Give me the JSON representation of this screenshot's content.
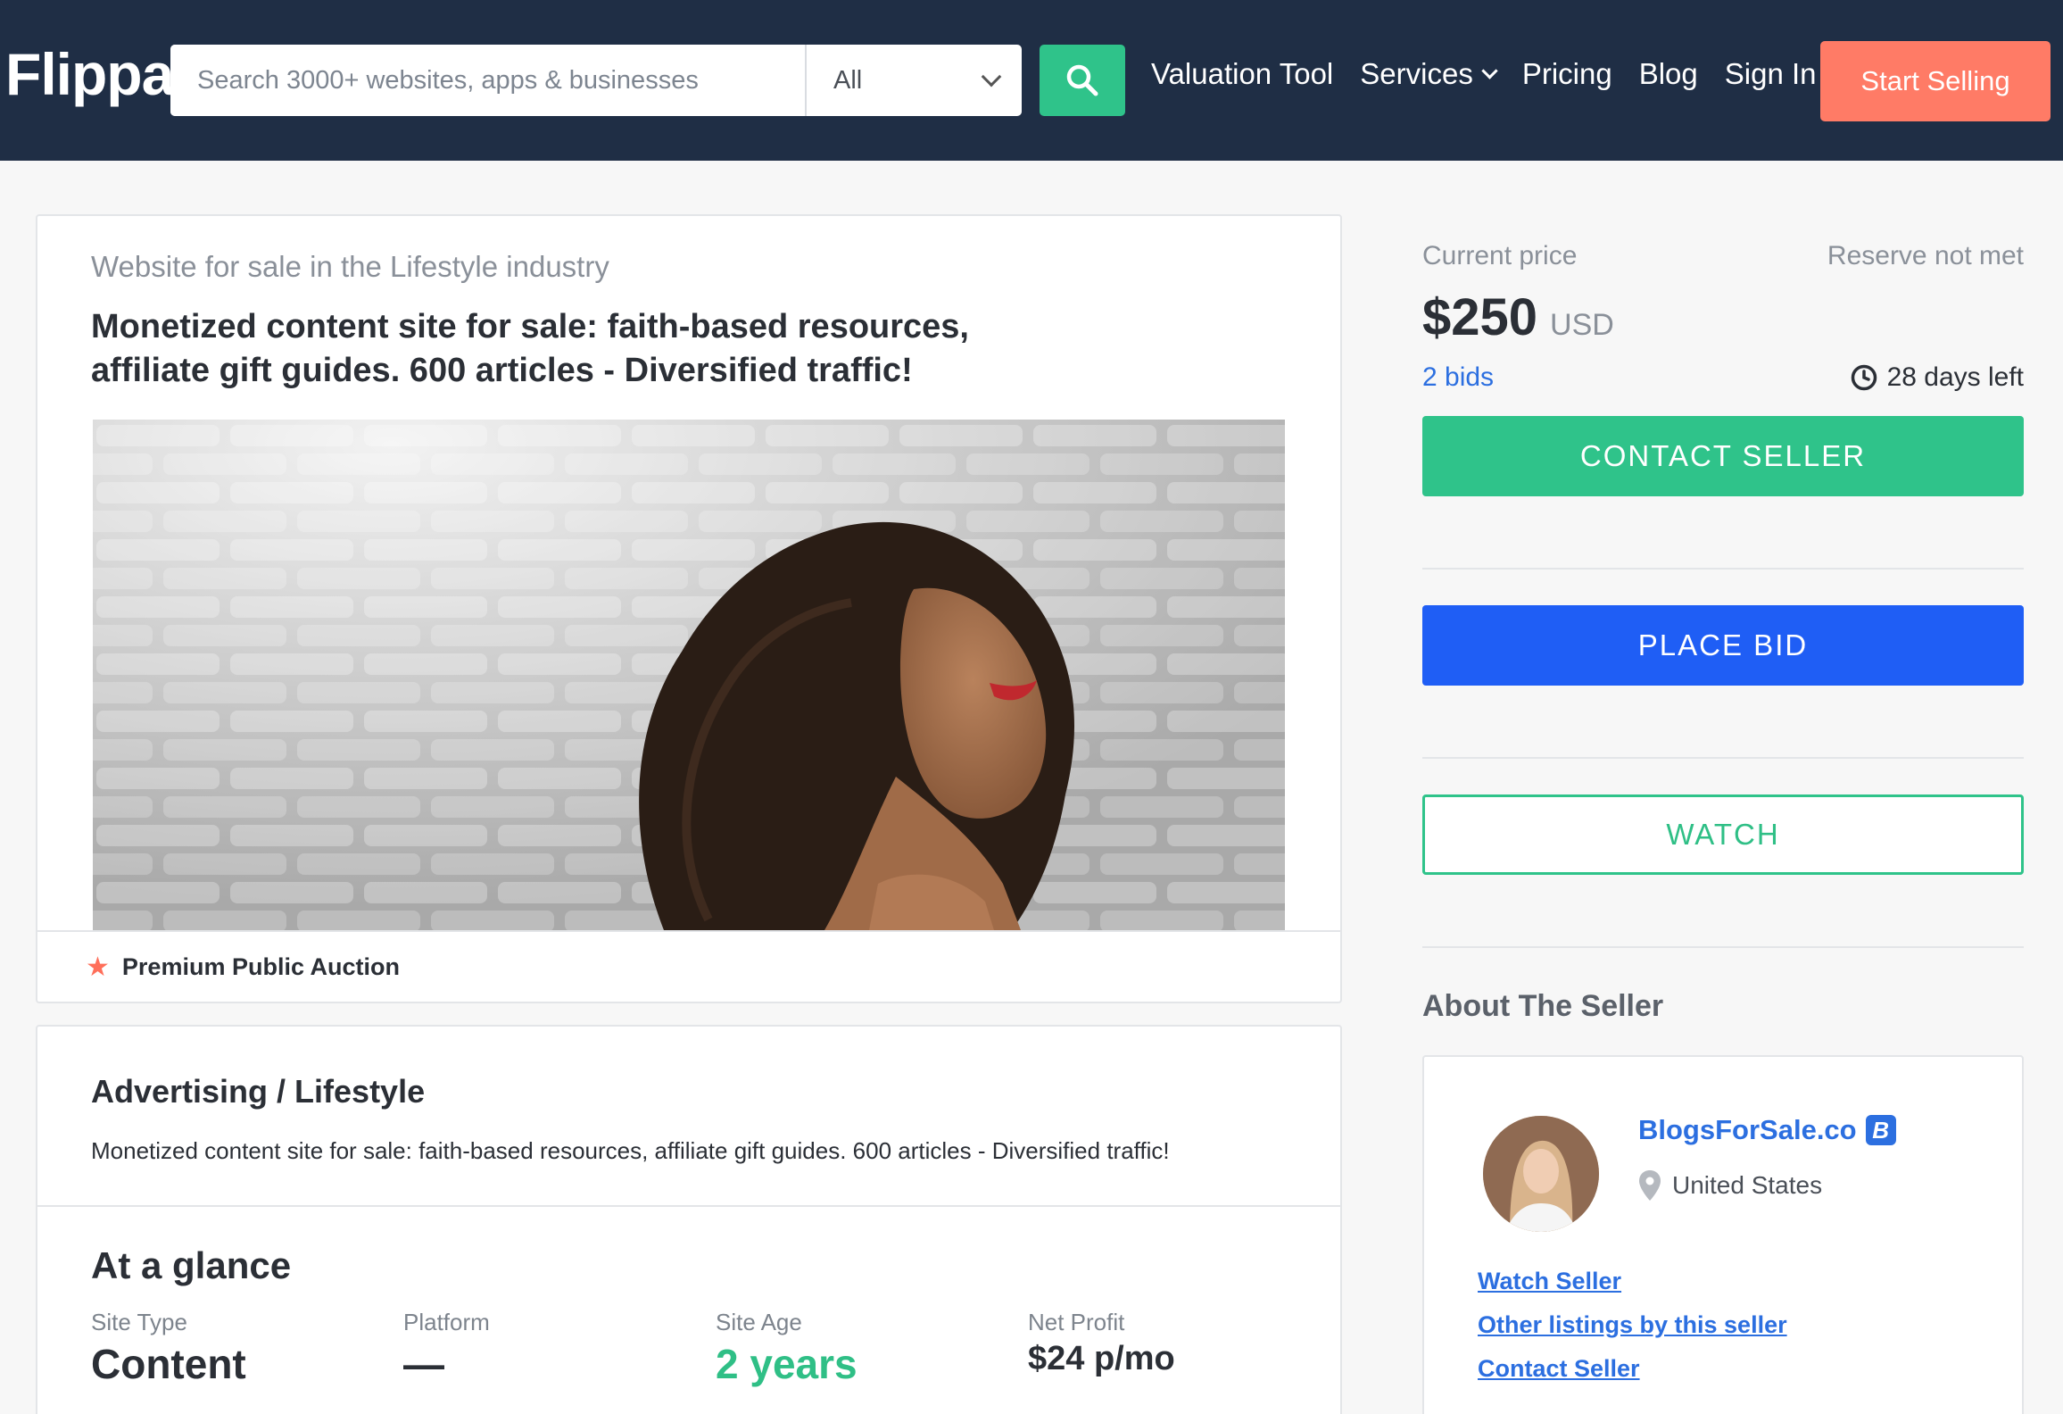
{
  "header": {
    "logo": "Flippa",
    "search_placeholder": "Search 3000+ websites, apps & businesses",
    "category_selected": "All",
    "nav": [
      {
        "label": "Valuation Tool"
      },
      {
        "label": "Services"
      },
      {
        "label": "Pricing"
      },
      {
        "label": "Blog"
      },
      {
        "label": "Sign In"
      }
    ],
    "start_selling": "Start Selling"
  },
  "listing": {
    "industry": "Website for sale in the Lifestyle industry",
    "title": "Monetized content site for sale: faith-based resources, affiliate gift guides. 600 articles - Diversified traffic!",
    "badge": "Premium Public Auction"
  },
  "details": {
    "category": "Advertising / Lifestyle",
    "description": "Monetized content site for sale: faith-based resources, affiliate gift guides. 600 articles - Diversified traffic!",
    "at_a_glance": "At a glance",
    "stats": [
      {
        "label": "Site Type",
        "value": "Content"
      },
      {
        "label": "Platform",
        "value": "—"
      },
      {
        "label": "Site Age",
        "value": "2 years"
      },
      {
        "label": "Net Profit",
        "value": "$24 p/mo"
      }
    ]
  },
  "auction": {
    "price_label": "Current price",
    "reserve": "Reserve not met",
    "price": "$250",
    "currency": "USD",
    "bids": "2 bids",
    "time_left": "28 days left",
    "contact_button": "CONTACT SELLER",
    "bid_button": "PLACE BID",
    "watch_button": "WATCH"
  },
  "seller": {
    "section_title": "About The Seller",
    "name": "BlogsForSale.co",
    "badge": "B",
    "location": "United States",
    "links": [
      "Watch Seller",
      "Other listings by this seller",
      "Contact Seller"
    ]
  },
  "colors": {
    "navbar": "#1f2e45",
    "green": "#2fc38a",
    "blue": "#1f5ef5",
    "coral": "#ff7b66",
    "link": "#2c6fe0"
  }
}
